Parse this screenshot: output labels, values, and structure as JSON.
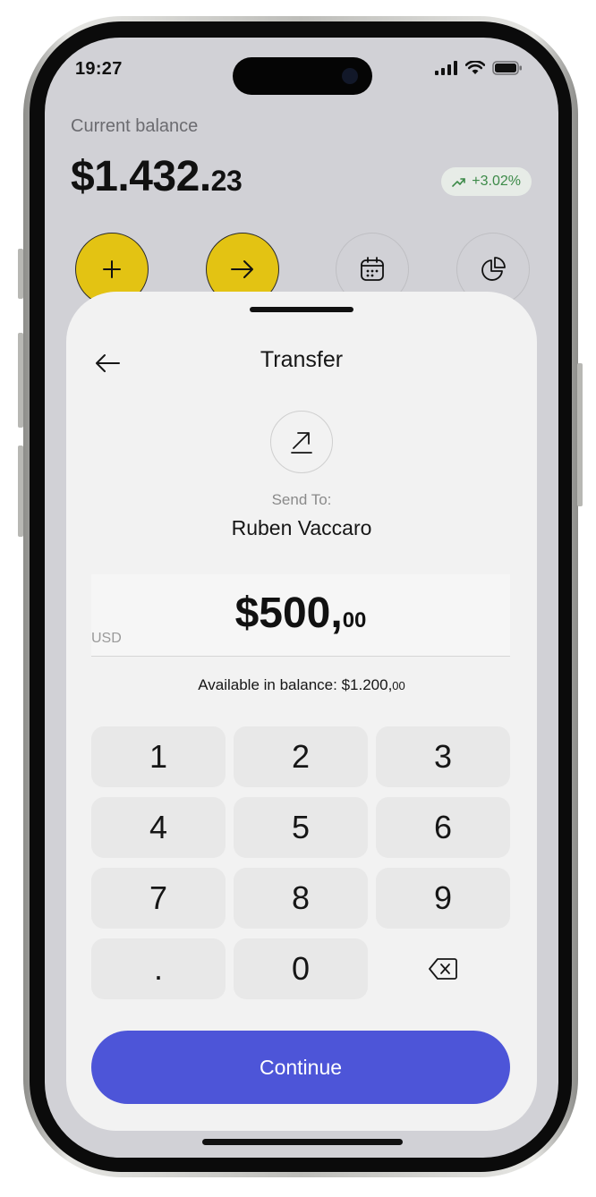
{
  "status_bar": {
    "time": "19:27",
    "icons": [
      "signal-icon",
      "wifi-icon",
      "battery-icon"
    ]
  },
  "balance": {
    "label": "Current balance",
    "amount_main": "$1.432.",
    "amount_cents": "23",
    "trend": "+3.02%",
    "trend_color": "#3c8a48"
  },
  "actions": [
    {
      "icon": "plus-icon",
      "color": "#e3c313"
    },
    {
      "icon": "arrow-right-icon",
      "color": "#e3c313"
    },
    {
      "icon": "calendar-icon"
    },
    {
      "icon": "pie-chart-icon"
    }
  ],
  "transfer": {
    "title": "Transfer",
    "send_to_label": "Send To:",
    "recipient": "Ruben Vaccaro",
    "currency": "USD",
    "amount_main": "$500,",
    "amount_decimal": "00",
    "available_label": "Available in balance: $1.200,",
    "available_decimal": "00"
  },
  "keypad": {
    "keys": [
      "1",
      "2",
      "3",
      "4",
      "5",
      "6",
      "7",
      "8",
      "9",
      ".",
      "0"
    ],
    "backspace_icon": "backspace-icon"
  },
  "continue_label": "Continue",
  "colors": {
    "accent": "#4d55d8",
    "yellow": "#e3c313"
  }
}
